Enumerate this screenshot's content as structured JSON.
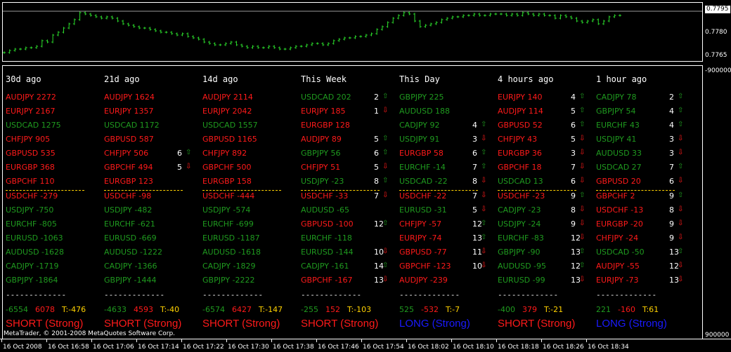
{
  "colors": {
    "up": "#1f9a1f",
    "down": "#ff1a1a",
    "bg": "#000000",
    "axis": "#ffffff",
    "sep": "#ffd200",
    "long": "#1a1aff",
    "short": "#ff1a1a",
    "chart": "#2bdc2b"
  },
  "price_axis": {
    "current": "0.7795",
    "labels": [
      "0.7780",
      "0.7765"
    ],
    "indicator_labels": [
      "-900000",
      "900000"
    ]
  },
  "copyright": "MetaTrader, © 2001-2008 MetaQuotes Software Corp.",
  "time_labels": [
    "16 Oct 2008",
    "16 Oct 16:58",
    "16 Oct 17:06",
    "16 Oct 17:14",
    "16 Oct 17:22",
    "16 Oct 17:30",
    "16 Oct 17:38",
    "16 Oct 17:46",
    "16 Oct 17:54",
    "16 Oct 18:02",
    "16 Oct 18:10",
    "16 Oct 18:18",
    "16 Oct 18:26",
    "16 Oct 18:34"
  ],
  "separator_text": "-------------",
  "columns": [
    {
      "header": "30d ago",
      "rows": [
        {
          "pair": "AUDJPY 2272",
          "color": "down"
        },
        {
          "pair": "EURJPY 2167",
          "color": "down"
        },
        {
          "pair": "USDCAD 1275",
          "color": "up"
        },
        {
          "pair": "CHFJPY 905",
          "color": "down"
        },
        {
          "pair": "GBPUSD 535",
          "color": "down"
        },
        {
          "pair": "EURGBP 368",
          "color": "down"
        },
        {
          "pair": "GBPCHF 110",
          "color": "down"
        },
        {
          "pair": "USDCHF -279",
          "color": "down"
        },
        {
          "pair": "USDJPY -750",
          "color": "up"
        },
        {
          "pair": "EURCHF -805",
          "color": "up"
        },
        {
          "pair": "EURUSD -1063",
          "color": "up"
        },
        {
          "pair": "AUDUSD -1628",
          "color": "up"
        },
        {
          "pair": "CADJPY -1719",
          "color": "up"
        },
        {
          "pair": "GBPJPY -1864",
          "color": "up"
        }
      ],
      "totals": {
        "a": "-6554",
        "b": "6078",
        "t": "T:-476"
      },
      "signal": "SHORT (Strong)",
      "signal_type": "short"
    },
    {
      "header": "21d ago",
      "rows": [
        {
          "pair": "AUDJPY 1624",
          "color": "down"
        },
        {
          "pair": "EURJPY 1357",
          "color": "down"
        },
        {
          "pair": "USDCAD 1172",
          "color": "up"
        },
        {
          "pair": "GBPUSD 587",
          "color": "down"
        },
        {
          "pair": "CHFJPY 506",
          "color": "down",
          "cnt": "6",
          "arr": "⇧",
          "arr_color": "up"
        },
        {
          "pair": "GBPCHF 494",
          "color": "down",
          "cnt": "5",
          "arr": "⇩",
          "arr_color": "down"
        },
        {
          "pair": "EURGBP 123",
          "color": "down"
        },
        {
          "pair": "USDCHF -98",
          "color": "down"
        },
        {
          "pair": "USDJPY -482",
          "color": "up"
        },
        {
          "pair": "EURCHF -621",
          "color": "up"
        },
        {
          "pair": "EURUSD -669",
          "color": "up"
        },
        {
          "pair": "AUDUSD -1222",
          "color": "up"
        },
        {
          "pair": "CADJPY -1366",
          "color": "up"
        },
        {
          "pair": "GBPJPY -1444",
          "color": "up"
        }
      ],
      "totals": {
        "a": "-4633",
        "b": "4593",
        "t": "T:-40"
      },
      "signal": "SHORT (Strong)",
      "signal_type": "short"
    },
    {
      "header": "14d ago",
      "rows": [
        {
          "pair": "AUDJPY 2114",
          "color": "down"
        },
        {
          "pair": "EURJPY 2042",
          "color": "down"
        },
        {
          "pair": "USDCAD 1557",
          "color": "up"
        },
        {
          "pair": "GBPUSD 1165",
          "color": "down"
        },
        {
          "pair": "CHFJPY 892",
          "color": "down"
        },
        {
          "pair": "GBPCHF 500",
          "color": "down"
        },
        {
          "pair": "EURGBP 158",
          "color": "down"
        },
        {
          "pair": "USDCHF -444",
          "color": "down"
        },
        {
          "pair": "USDJPY -574",
          "color": "up"
        },
        {
          "pair": "EURCHF -699",
          "color": "up"
        },
        {
          "pair": "EURUSD -1187",
          "color": "up"
        },
        {
          "pair": "AUDUSD -1618",
          "color": "up"
        },
        {
          "pair": "CADJPY -1829",
          "color": "up"
        },
        {
          "pair": "GBPJPY -2222",
          "color": "up"
        }
      ],
      "totals": {
        "a": "-6574",
        "b": "6427",
        "t": "T:-147"
      },
      "signal": "SHORT (Strong)",
      "signal_type": "short"
    },
    {
      "header": "This Week",
      "rows": [
        {
          "pair": "USDCAD 202",
          "color": "up",
          "cnt": "2",
          "arr": "⇧",
          "arr_color": "up"
        },
        {
          "pair": "EURJPY 185",
          "color": "down",
          "cnt": "1",
          "arr": "⇩",
          "arr_color": "down"
        },
        {
          "pair": "EURGBP 128",
          "color": "down"
        },
        {
          "pair": "AUDJPY 89",
          "color": "down",
          "cnt": "5",
          "arr": "⇧",
          "arr_color": "up"
        },
        {
          "pair": "GBPJPY 56",
          "color": "up",
          "cnt": "6",
          "arr": "⇧",
          "arr_color": "up"
        },
        {
          "pair": "CHFJPY 51",
          "color": "down",
          "cnt": "5",
          "arr": "⇩",
          "arr_color": "down"
        },
        {
          "pair": "USDJPY -23",
          "color": "up",
          "cnt": "8",
          "arr": "⇧",
          "arr_color": "up"
        },
        {
          "pair": "USDCHF -33",
          "color": "down",
          "cnt": "7",
          "arr": "⇩",
          "arr_color": "down"
        },
        {
          "pair": "AUDUSD -65",
          "color": "up"
        },
        {
          "pair": "GBPUSD -100",
          "color": "down",
          "cnt": "12",
          "arr": "⇧",
          "arr_color": "up"
        },
        {
          "pair": "EURCHF -118",
          "color": "up"
        },
        {
          "pair": "EURUSD -144",
          "color": "up",
          "cnt": "10",
          "arr": "⇩",
          "arr_color": "down"
        },
        {
          "pair": "CADJPY -161",
          "color": "up",
          "cnt": "14",
          "arr": "⇧",
          "arr_color": "up"
        },
        {
          "pair": "GBPCHF -167",
          "color": "down",
          "cnt": "13",
          "arr": "⇩",
          "arr_color": "down"
        }
      ],
      "totals": {
        "a": "-255",
        "b": "152",
        "t": "T:-103"
      },
      "signal": "SHORT (Strong)",
      "signal_type": "short"
    },
    {
      "header": "This Day",
      "rows": [
        {
          "pair": "GBPJPY 225",
          "color": "up"
        },
        {
          "pair": "AUDUSD 188",
          "color": "up"
        },
        {
          "pair": "CADJPY 92",
          "color": "up",
          "cnt": "4",
          "arr": "⇧",
          "arr_color": "up"
        },
        {
          "pair": "USDJPY 91",
          "color": "up",
          "cnt": "3",
          "arr": "⇩",
          "arr_color": "down"
        },
        {
          "pair": "EURGBP 58",
          "color": "down",
          "cnt": "6",
          "arr": "⇧",
          "arr_color": "up"
        },
        {
          "pair": "EURCHF -14",
          "color": "up",
          "cnt": "7",
          "arr": "⇧",
          "arr_color": "up"
        },
        {
          "pair": "USDCAD -22",
          "color": "up",
          "cnt": "8",
          "arr": "⇩",
          "arr_color": "down"
        },
        {
          "pair": "USDCHF -22",
          "color": "down",
          "cnt": "7",
          "arr": "⇩",
          "arr_color": "down"
        },
        {
          "pair": "EURUSD -31",
          "color": "up",
          "cnt": "5",
          "arr": "⇩",
          "arr_color": "down"
        },
        {
          "pair": "CHFJPY -57",
          "color": "down",
          "cnt": "12",
          "arr": "⇧",
          "arr_color": "up"
        },
        {
          "pair": "EURJPY -74",
          "color": "down",
          "cnt": "13",
          "arr": "⇧",
          "arr_color": "up"
        },
        {
          "pair": "GBPUSD -77",
          "color": "down",
          "cnt": "11",
          "arr": "⇩",
          "arr_color": "down"
        },
        {
          "pair": "GBPCHF -123",
          "color": "down",
          "cnt": "10",
          "arr": "⇩",
          "arr_color": "down"
        },
        {
          "pair": "AUDJPY -239",
          "color": "down"
        }
      ],
      "totals": {
        "a": "525",
        "b": "-532",
        "t": "T:-7"
      },
      "signal": "LONG (Strong)",
      "signal_type": "long"
    },
    {
      "header": "4 hours ago",
      "rows": [
        {
          "pair": "EURJPY 140",
          "color": "down",
          "cnt": "4",
          "arr": "⇧",
          "arr_color": "up"
        },
        {
          "pair": "AUDJPY 114",
          "color": "down",
          "cnt": "5",
          "arr": "⇧",
          "arr_color": "up"
        },
        {
          "pair": "GBPUSD 52",
          "color": "down",
          "cnt": "6",
          "arr": "⇧",
          "arr_color": "up"
        },
        {
          "pair": "CHFJPY 43",
          "color": "down",
          "cnt": "5",
          "arr": "⇩",
          "arr_color": "down"
        },
        {
          "pair": "EURGBP 36",
          "color": "down",
          "cnt": "3",
          "arr": "⇩",
          "arr_color": "down"
        },
        {
          "pair": "GBPCHF 18",
          "color": "down",
          "cnt": "7",
          "arr": "⇩",
          "arr_color": "down"
        },
        {
          "pair": "USDCAD 13",
          "color": "up",
          "cnt": "6",
          "arr": "⇩",
          "arr_color": "down"
        },
        {
          "pair": "USDCHF -23",
          "color": "down",
          "cnt": "9",
          "arr": "⇧",
          "arr_color": "up"
        },
        {
          "pair": "CADJPY -23",
          "color": "up",
          "cnt": "8",
          "arr": "⇩",
          "arr_color": "down"
        },
        {
          "pair": "USDJPY -24",
          "color": "up",
          "cnt": "9",
          "arr": "⇩",
          "arr_color": "down"
        },
        {
          "pair": "EURCHF -83",
          "color": "up",
          "cnt": "12",
          "arr": "⇩",
          "arr_color": "down"
        },
        {
          "pair": "GBPJPY -90",
          "color": "up",
          "cnt": "13",
          "arr": "⇧",
          "arr_color": "up"
        },
        {
          "pair": "AUDUSD -95",
          "color": "up",
          "cnt": "12",
          "arr": "⇧",
          "arr_color": "up"
        },
        {
          "pair": "EURUSD -99",
          "color": "up",
          "cnt": "13",
          "arr": "⇩",
          "arr_color": "down"
        }
      ],
      "totals": {
        "a": "-400",
        "b": "379",
        "t": "T:-21"
      },
      "signal": "SHORT (Strong)",
      "signal_type": "short"
    },
    {
      "header": "1 hour ago",
      "rows": [
        {
          "pair": "CADJPY 78",
          "color": "up",
          "cnt": "2",
          "arr": "⇧",
          "arr_color": "up"
        },
        {
          "pair": "GBPJPY 54",
          "color": "up",
          "cnt": "4",
          "arr": "⇧",
          "arr_color": "up"
        },
        {
          "pair": "EURCHF 43",
          "color": "up",
          "cnt": "4",
          "arr": "⇧",
          "arr_color": "up"
        },
        {
          "pair": "USDJPY 41",
          "color": "up",
          "cnt": "3",
          "arr": "⇩",
          "arr_color": "down"
        },
        {
          "pair": "AUDUSD 33",
          "color": "up",
          "cnt": "3",
          "arr": "⇩",
          "arr_color": "down"
        },
        {
          "pair": "USDCAD 27",
          "color": "up",
          "cnt": "7",
          "arr": "⇧",
          "arr_color": "up"
        },
        {
          "pair": "GBPUSD 20",
          "color": "down",
          "cnt": "6",
          "arr": "⇩",
          "arr_color": "down"
        },
        {
          "pair": "GBPCHF 2",
          "color": "down",
          "cnt": "9",
          "arr": "⇧",
          "arr_color": "up"
        },
        {
          "pair": "USDCHF -13",
          "color": "down",
          "cnt": "8",
          "arr": "⇩",
          "arr_color": "down"
        },
        {
          "pair": "EURGBP -20",
          "color": "down",
          "cnt": "9",
          "arr": "⇩",
          "arr_color": "down"
        },
        {
          "pair": "CHFJPY -24",
          "color": "down",
          "cnt": "9",
          "arr": "⇩",
          "arr_color": "down"
        },
        {
          "pair": "USDCAD -50",
          "color": "up",
          "cnt": "13",
          "arr": "⇧",
          "arr_color": "up"
        },
        {
          "pair": "AUDJPY -55",
          "color": "down",
          "cnt": "12",
          "arr": "⇩",
          "arr_color": "down"
        },
        {
          "pair": "EURJPY -73",
          "color": "down",
          "cnt": "13",
          "arr": "⇩",
          "arr_color": "down"
        }
      ],
      "totals": {
        "a": "221",
        "b": "-160",
        "t": "T:61"
      },
      "signal": "LONG (Strong)",
      "signal_type": "long"
    }
  ],
  "chart_data": {
    "type": "line",
    "title": "",
    "ylim": [
      0.776,
      0.78
    ],
    "series": [
      {
        "values": [
          0.77655,
          0.7767,
          0.7768,
          0.7768,
          0.7769,
          0.7769,
          0.777,
          0.7774,
          0.7773,
          0.7778,
          0.778,
          0.7783,
          0.7786,
          0.7789,
          0.7794,
          0.7793,
          0.7792,
          0.7791,
          0.779,
          0.7791,
          0.779,
          0.7788,
          0.7786,
          0.7785,
          0.7784,
          0.7783,
          0.7783,
          0.7782,
          0.7781,
          0.778,
          0.778,
          0.7779,
          0.7778,
          0.7779,
          0.7777,
          0.7776,
          0.7775,
          0.7773,
          0.7772,
          0.7771,
          0.7771,
          0.7772,
          0.7773,
          0.7771,
          0.777,
          0.7769,
          0.777,
          0.7769,
          0.7769,
          0.777,
          0.7769,
          0.7768,
          0.7768,
          0.7769,
          0.777,
          0.777,
          0.7771,
          0.7772,
          0.7772,
          0.7771,
          0.7772,
          0.7774,
          0.7775,
          0.7776,
          0.7776,
          0.7777,
          0.7777,
          0.7778,
          0.7779,
          0.7782,
          0.7784,
          0.7787,
          0.779,
          0.7792,
          0.7794,
          0.7793,
          0.7788,
          0.7784,
          0.7785,
          0.7786,
          0.7787,
          0.7789,
          0.779,
          0.7791,
          0.7791,
          0.7792,
          0.7792,
          0.7793,
          0.7792,
          0.7792,
          0.7793,
          0.7793,
          0.7793,
          0.7792,
          0.7793,
          0.7792,
          0.7794,
          0.7793,
          0.7792,
          0.7793,
          0.7792,
          0.7792,
          0.779,
          0.7792,
          0.7791,
          0.779,
          0.7788,
          0.7787,
          0.7788,
          0.7789,
          0.7786,
          0.7788,
          0.7791,
          0.7792,
          0.7792
        ]
      }
    ]
  }
}
